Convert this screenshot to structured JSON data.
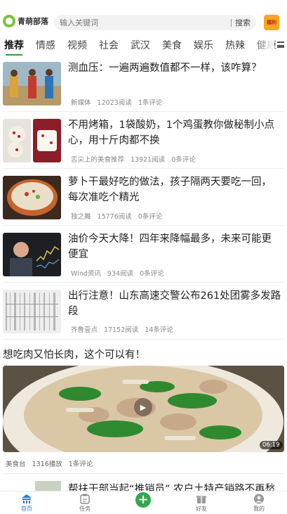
{
  "header": {
    "logo_text": "青萌部落",
    "search_placeholder": "输入关键词",
    "search_button": "搜索",
    "gift_label": "福利"
  },
  "tabs": [
    {
      "label": "推荐",
      "active": true
    },
    {
      "label": "情感"
    },
    {
      "label": "视频"
    },
    {
      "label": "社会"
    },
    {
      "label": "武汉"
    },
    {
      "label": "美食"
    },
    {
      "label": "娱乐"
    },
    {
      "label": "热辣"
    },
    {
      "label": "健康"
    }
  ],
  "articles": [
    {
      "title": "测血压：一遍两遍数值都不一样，该咋算？",
      "source": "新媒体",
      "reads": "12023阅读",
      "comments": "1条评论"
    },
    {
      "title": "不用烤箱，1袋酸奶，1个鸡蛋教你做秘制小点心，用十斤肉都不换",
      "source": "舌尖上的美食推荐",
      "reads": "13921阅读",
      "comments": "0条评论"
    },
    {
      "title": "萝卜干最好吃的做法，孩子隔两天要吃一回，每次准吃个精光",
      "source": "独之舞",
      "reads": "15776阅读",
      "comments": "0条评论"
    },
    {
      "title": "油价今天大降！四年来降幅最多，未来可能更便宜",
      "source": "Wind资讯",
      "reads": "934阅读",
      "comments": "0条评论"
    },
    {
      "title": "出行注意！山东高速交警公布261处团雾多发路段",
      "source": "齐鲁壹点",
      "reads": "17152阅读",
      "comments": "14条评论"
    }
  ],
  "video": {
    "title": "想吃肉又怕长肉，这个可以有！",
    "duration": "06:19",
    "source": "美食台",
    "plays": "1316播放",
    "comments": "1条评论"
  },
  "last_article": {
    "title": "帮扶干部当起“推销员” 农户土特产销路不再愁"
  },
  "bottom_nav": [
    {
      "label": "首页",
      "icon": "home-icon",
      "active": true
    },
    {
      "label": "任务",
      "icon": "task-icon"
    },
    {
      "label": "",
      "icon": "plus-icon"
    },
    {
      "label": "好友",
      "icon": "friends-icon"
    },
    {
      "label": "我的",
      "icon": "profile-icon"
    }
  ],
  "colors": {
    "accent_green": "#2aa13b",
    "nav_active_blue": "#2a7fd4"
  }
}
